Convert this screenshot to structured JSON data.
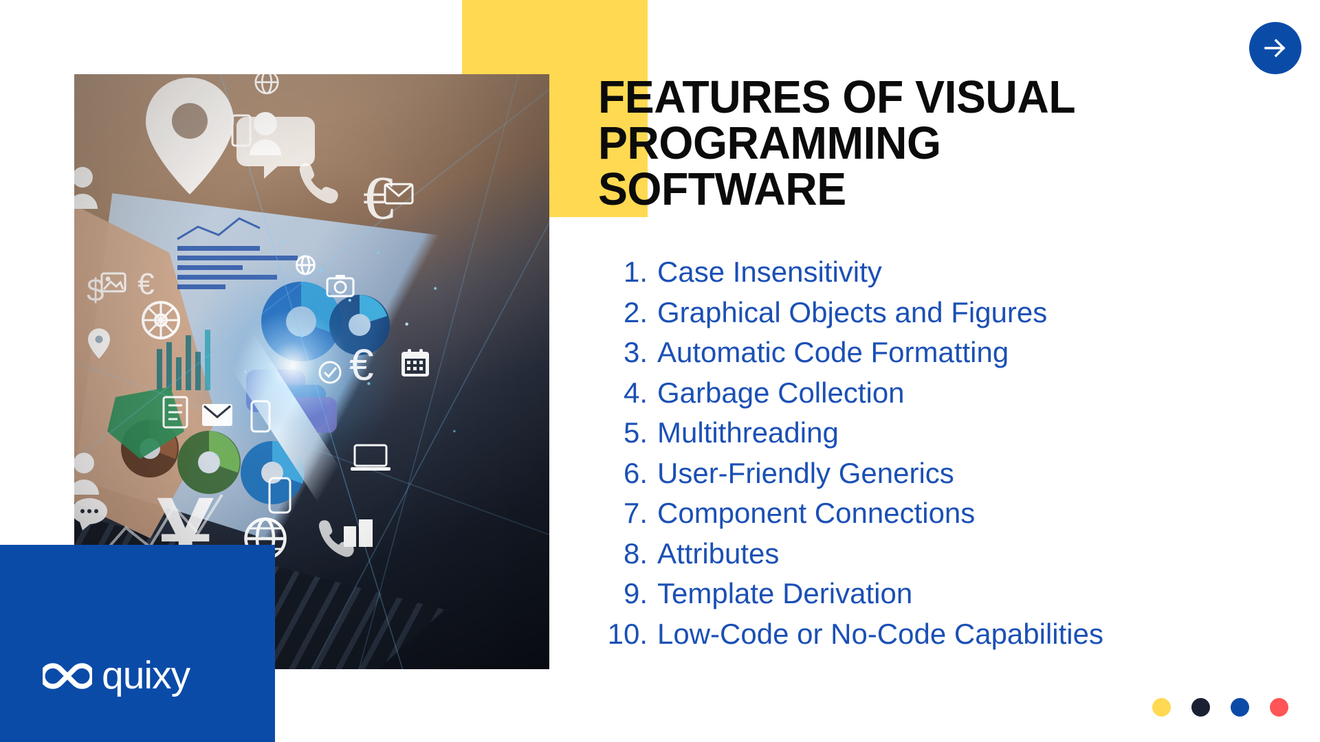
{
  "slide": {
    "title": "FEATURES OF VISUAL\nPROGRAMMING\nSOFTWARE",
    "title_line1": "FEATURES OF VISUAL",
    "title_line2": "PROGRAMMING",
    "title_line3": "SOFTWARE"
  },
  "features": [
    {
      "number": "1.",
      "label": "Case Insensitivity"
    },
    {
      "number": "2.",
      "label": "Graphical Objects and Figures"
    },
    {
      "number": "3.",
      "label": "Automatic Code Formatting"
    },
    {
      "number": "4.",
      "label": "Garbage Collection"
    },
    {
      "number": "5.",
      "label": "Multithreading"
    },
    {
      "number": "6.",
      "label": "User-Friendly Generics"
    },
    {
      "number": "7.",
      "label": "Component Connections"
    },
    {
      "number": "8.",
      "label": "Attributes"
    },
    {
      "number": "9.",
      "label": "Template Derivation"
    },
    {
      "number": "10.",
      "label": "Low-Code or No-Code Capabilities"
    }
  ],
  "brand": {
    "name": "quixy",
    "logo_icon": "interlocking-loops-icon"
  },
  "controls": {
    "next_icon": "arrow-right-icon",
    "next_label": "Next"
  },
  "dots": [
    {
      "name": "dot-yellow",
      "color": "#FFD951"
    },
    {
      "name": "dot-navy",
      "color": "#1C2033"
    },
    {
      "name": "dot-blue",
      "color": "#0B4BA8"
    },
    {
      "name": "dot-red",
      "color": "#FF5557"
    }
  ],
  "colors": {
    "accent_yellow": "#FFD951",
    "accent_blue": "#0B4BA8",
    "list_blue": "#1B50B5",
    "title_black": "#0B0B0B",
    "accent_red": "#FF5557",
    "accent_navy": "#1C2033",
    "background": "#FFFFFF"
  },
  "photo": {
    "alt": "hand using a stylus on a tablet showing glowing data charts and technology icons over a laptop keyboard"
  }
}
